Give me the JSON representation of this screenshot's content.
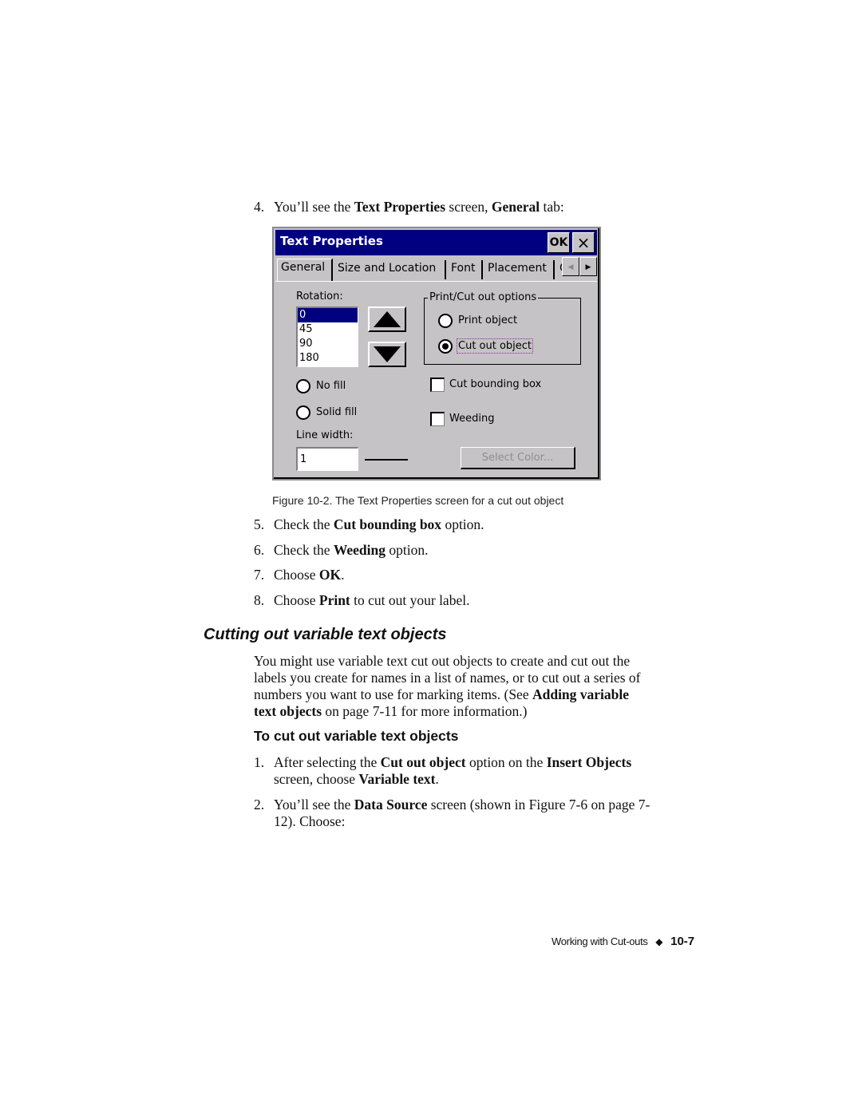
{
  "intro_step": {
    "number": "4.",
    "parts": [
      {
        "text": "You’ll see the ",
        "bold": false
      },
      {
        "text": "Text Properties",
        "bold": true
      },
      {
        "text": " screen, ",
        "bold": false
      },
      {
        "text": "General",
        "bold": true
      },
      {
        "text": " tab:",
        "bold": false
      }
    ]
  },
  "dialog": {
    "title": "Text Properties",
    "ok_label": "OK",
    "close_label": "×",
    "tabs": [
      {
        "label": "General",
        "active": true
      },
      {
        "label": "Size and Location",
        "active": false
      },
      {
        "label": "Font",
        "active": false
      },
      {
        "label": "Placement",
        "active": false
      },
      {
        "label": "C",
        "active": false
      }
    ],
    "scroll_left": "◀",
    "scroll_right": "▶",
    "rotation_label": "Rotation:",
    "rotation_options": [
      "0",
      "45",
      "90",
      "180"
    ],
    "rotation_selected": "0",
    "up_arrow": "▲",
    "down_arrow": "▼",
    "print_cut_group_label": "Print/Cut out options",
    "print_object_label": "Print object",
    "print_object_selected": false,
    "cut_out_object_label": "Cut out object",
    "cut_out_object_selected": true,
    "no_fill_label": "No fill",
    "no_fill_selected": false,
    "solid_fill_label": "Solid fill",
    "solid_fill_selected": false,
    "cut_bounding_box_label": "Cut bounding box",
    "cut_bounding_box_checked": false,
    "weeding_label": "Weeding",
    "weeding_checked": false,
    "line_width_label": "Line width:",
    "line_width_value": "1",
    "select_color_label": "Select Color...",
    "select_color_enabled": false,
    "colors": {
      "titlebar": "#000080",
      "face": "#c6c3c6",
      "selection": "#000080"
    }
  },
  "figure_caption": "Figure 10-2. The Text Properties screen for a cut out object",
  "steps_after": [
    {
      "number": "5.",
      "parts": [
        {
          "text": "Check the ",
          "bold": false
        },
        {
          "text": "Cut bounding box",
          "bold": true
        },
        {
          "text": " option.",
          "bold": false
        }
      ]
    },
    {
      "number": "6.",
      "parts": [
        {
          "text": "Check the ",
          "bold": false
        },
        {
          "text": "Weeding",
          "bold": true
        },
        {
          "text": " option.",
          "bold": false
        }
      ]
    },
    {
      "number": "7.",
      "parts": [
        {
          "text": "Choose ",
          "bold": false
        },
        {
          "text": "OK",
          "bold": true
        },
        {
          "text": ".",
          "bold": false
        }
      ]
    },
    {
      "number": "8.",
      "parts": [
        {
          "text": "Choose ",
          "bold": false
        },
        {
          "text": "Print",
          "bold": true
        },
        {
          "text": " to cut out your label.",
          "bold": false
        }
      ]
    }
  ],
  "section_heading": "Cutting out variable text objects",
  "section_paragraph": {
    "lines": [
      [
        {
          "text": "You might use variable text cut out objects to create and cut out the",
          "bold": false
        }
      ],
      [
        {
          "text": "labels you create for names in a list of names, or to cut out a series of",
          "bold": false
        }
      ],
      [
        {
          "text": "numbers you want to use for marking items. (See ",
          "bold": false
        },
        {
          "text": "Adding variable",
          "bold": true
        }
      ],
      [
        {
          "text": "text objects",
          "bold": true
        },
        {
          "text": " on page 7-11 for more information.)",
          "bold": false
        }
      ]
    ]
  },
  "subheading": "To cut out variable text objects",
  "procedure_steps": [
    {
      "number": "1.",
      "lines": [
        [
          {
            "text": "After selecting the ",
            "bold": false
          },
          {
            "text": "Cut out object",
            "bold": true
          },
          {
            "text": " option on the ",
            "bold": false
          },
          {
            "text": "Insert Objects",
            "bold": true
          }
        ],
        [
          {
            "text": "screen, choose ",
            "bold": false
          },
          {
            "text": "Variable text",
            "bold": true
          },
          {
            "text": ".",
            "bold": false
          }
        ]
      ]
    },
    {
      "number": "2.",
      "lines": [
        [
          {
            "text": "You’ll see the ",
            "bold": false
          },
          {
            "text": "Data Source",
            "bold": true
          },
          {
            "text": " screen (shown in Figure 7-6 on page 7-",
            "bold": false
          }
        ],
        [
          {
            "text": "12). Choose:",
            "bold": false
          }
        ]
      ]
    }
  ],
  "footer": {
    "chapter_title": "Working with Cut-outs",
    "separator": "◆",
    "page_number": "10-7"
  }
}
